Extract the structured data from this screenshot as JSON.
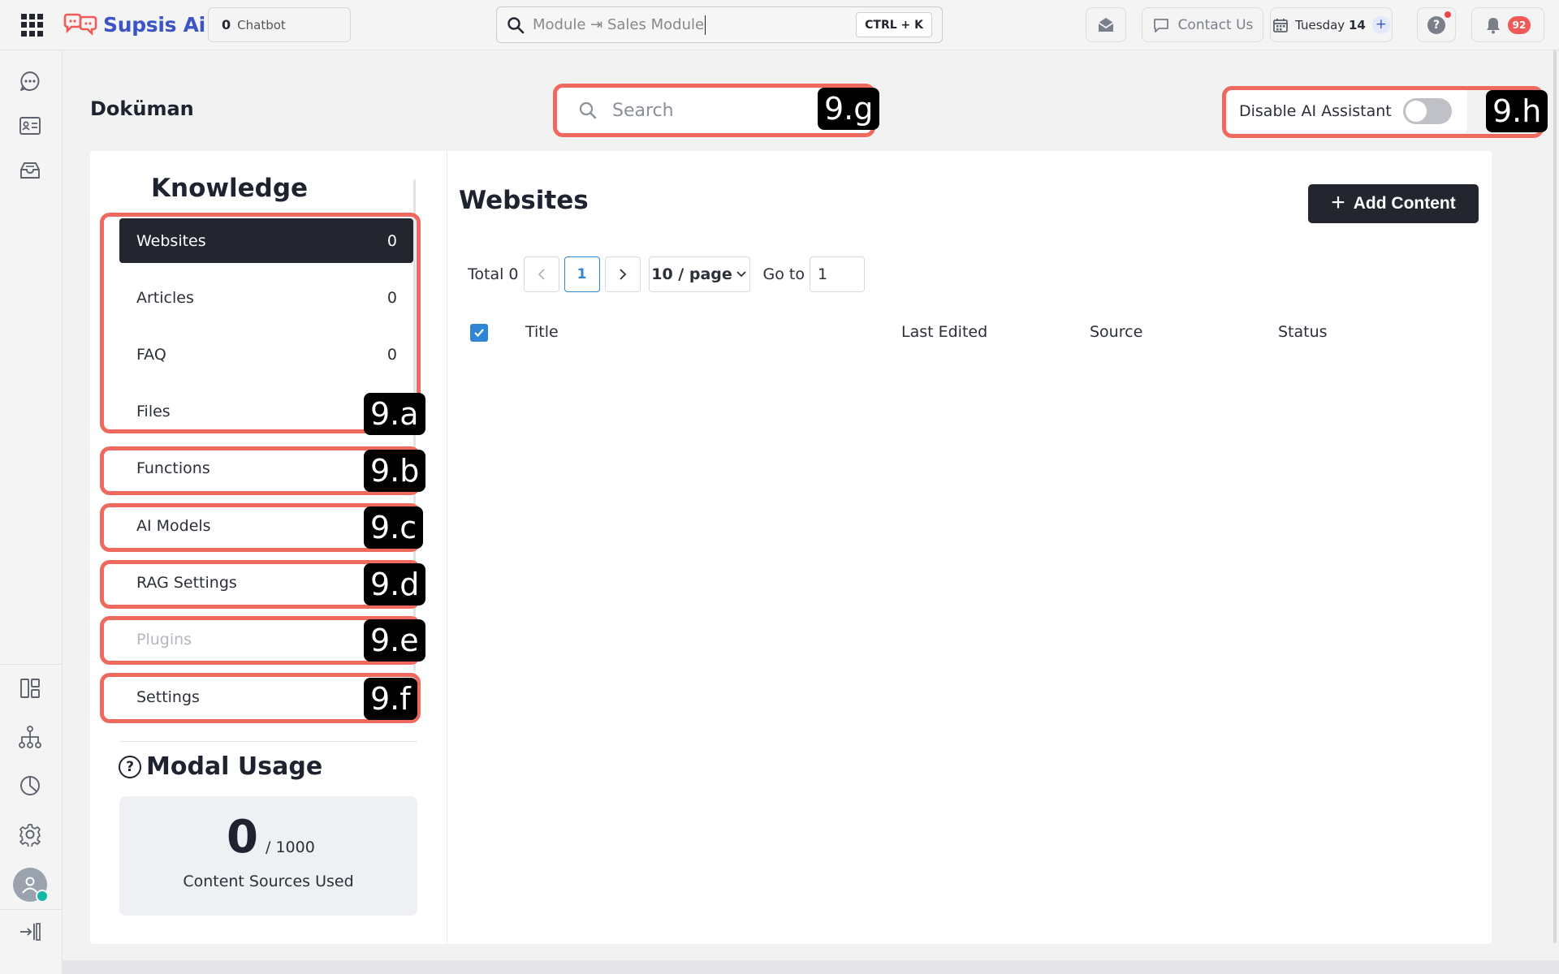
{
  "topbar": {
    "logo_text": "Supsis Ai",
    "chatbot_count": "0",
    "chatbot_label": "Chatbot",
    "global_search_value": "Module ⇥ Sales Module",
    "shortcut": "CTRL + K",
    "contact_label": "Contact Us",
    "date_day": "Tuesday",
    "date_num": "14",
    "notification_count": "92"
  },
  "page": {
    "title": "Doküman",
    "search_placeholder": "Search",
    "ai_toggle_label": "Disable AI Assistant",
    "ai_toggle_on": false
  },
  "knowledge": {
    "title": "Knowledge",
    "items": [
      {
        "label": "Websites",
        "count": "0"
      },
      {
        "label": "Articles",
        "count": "0"
      },
      {
        "label": "FAQ",
        "count": "0"
      },
      {
        "label": "Files",
        "count": ""
      },
      {
        "label": "Functions",
        "count": ""
      },
      {
        "label": "AI Models",
        "count": ""
      },
      {
        "label": "RAG Settings",
        "count": ""
      },
      {
        "label": "Plugins",
        "count": ""
      },
      {
        "label": "Settings",
        "count": ""
      }
    ]
  },
  "usage": {
    "title": "Modal Usage",
    "used": "0",
    "total": "/ 1000",
    "label": "Content Sources Used"
  },
  "content": {
    "title": "Websites",
    "add_label": "Add Content",
    "total_label": "Total 0",
    "current_page": "1",
    "page_size": "10 / page",
    "goto_label": "Go to",
    "goto_value": "1",
    "columns": [
      "Title",
      "Last Edited",
      "Source",
      "Status"
    ]
  },
  "annotations": [
    "9.a",
    "9.b",
    "9.c",
    "9.d",
    "9.e",
    "9.f",
    "9.g",
    "9.h"
  ],
  "colors": {
    "brand": "#3b55c4",
    "dark": "#23262f",
    "annotation": "#f0695e",
    "accent_blue": "#2f86d6",
    "badge_red": "#f05a57"
  }
}
